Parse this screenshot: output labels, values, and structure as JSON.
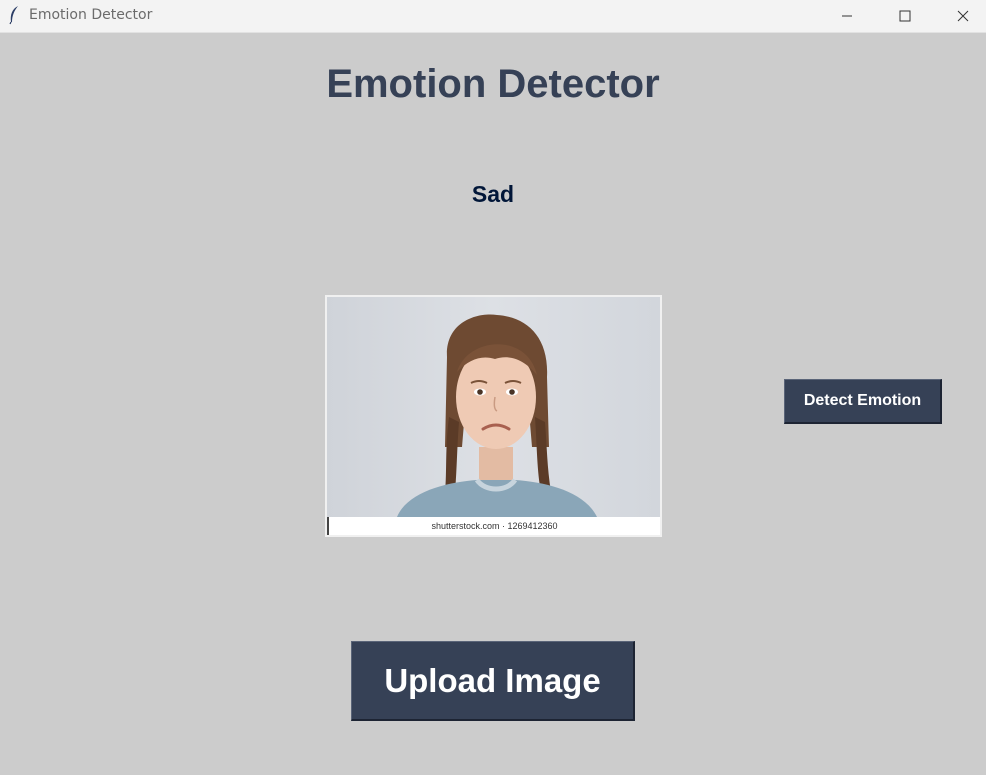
{
  "window": {
    "title": "Emotion Detector",
    "icon": "feather-icon",
    "controls": [
      "minimize-icon",
      "maximize-icon",
      "close-icon"
    ]
  },
  "main": {
    "heading": "Emotion Detector",
    "result_label": "Sad",
    "image": {
      "watermark_text": "shutterstock.com · 1269412360"
    },
    "detect_button_label": "Detect Emotion",
    "upload_button_label": "Upload Image"
  },
  "colors": {
    "background": "#cccccc",
    "heading": "#364156",
    "result": "#011638",
    "button_bg": "#364156",
    "button_text": "#ffffff"
  }
}
